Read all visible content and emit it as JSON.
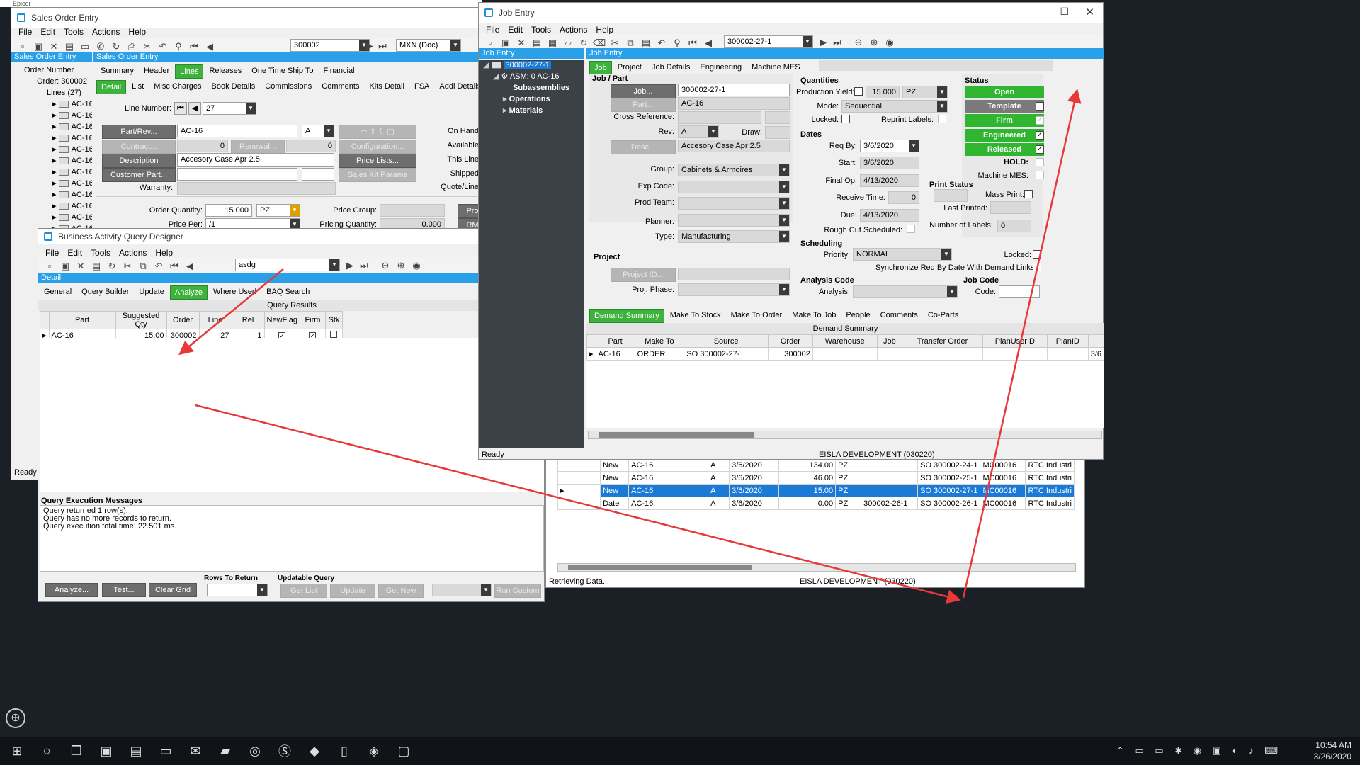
{
  "taskbar_top_title": "Epicor",
  "sales": {
    "title": "Sales Order Entry",
    "menu": [
      "File",
      "Edit",
      "Tools",
      "Actions",
      "Help"
    ],
    "order_number": "300002",
    "currency": "MXN (Doc)",
    "tree_header": "Sales Order Entry",
    "panel_header": "Sales Order Entry",
    "tree": {
      "root": "Order Number",
      "order": "Order: 300002",
      "lines": "Lines (27)",
      "item": "AC-16",
      "count": 18
    },
    "tabs": [
      "Summary",
      "Header",
      "Lines",
      "Releases",
      "One Time Ship To",
      "Financial"
    ],
    "active_tab": "Lines",
    "subtabs": [
      "Detail",
      "List",
      "Misc Charges",
      "Book Details",
      "Commissions",
      "Comments",
      "Kits Detail",
      "FSA",
      "Addl Details"
    ],
    "active_subtab": "Detail",
    "line_number_label": "Line Number:",
    "line_number": "27",
    "part_rev_btn": "Part/Rev...",
    "part": "AC-16",
    "rev": "A",
    "contract_btn": "Contract...",
    "contract_val": "0",
    "renewal_btn": "Renewal...",
    "renewal_val": "0",
    "configuration_btn": "Configuration...",
    "description_btn": "Description",
    "description": "Accesory Case Apr 2.5",
    "price_lists_btn": "Price Lists...",
    "customer_part_btn": "Customer Part...",
    "sales_kit_btn": "Sales Kit Params",
    "warranty_label": "Warranty:",
    "right_labels": [
      "On Hand",
      "Available",
      "This Line",
      "Shipped",
      "Quote/Line"
    ],
    "order_qty_label": "Order Quantity:",
    "order_qty": "15.000",
    "uom": "PZ",
    "price_group_label": "Price Group:",
    "price_per_label": "Price Per:",
    "price_per": "/1",
    "pricing_qty_label": "Pricing Quantity:",
    "pricing_qty": "0.000",
    "pro_btn": "Pro",
    "rm_btn": "RM",
    "status": "Ready"
  },
  "baq": {
    "title": "Business Activity Query Designer",
    "menu": [
      "File",
      "Edit",
      "Tools",
      "Actions",
      "Help"
    ],
    "query_id": "asdg",
    "detail": "Detail",
    "tabs": [
      "General",
      "Query Builder",
      "Update",
      "Analyze",
      "Where Used",
      "BAQ Search"
    ],
    "active_tab": "Analyze",
    "results_title": "Query Results",
    "columns": [
      "Part",
      "Suggested Qty",
      "Order",
      "Line",
      "Rel",
      "NewFlag",
      "Firm",
      "Stk"
    ],
    "row": {
      "part": "AC-16",
      "qty": "15.00",
      "order": "300002",
      "line": "27",
      "rel": "1"
    },
    "messages_title": "Query Execution Messages",
    "messages": [
      "Query returned 1 row(s).",
      "Query has no more records to return.",
      "Query execution total time: 22.501 ms."
    ],
    "btn_analyze": "Analyze...",
    "btn_test": "Test...",
    "btn_clear": "Clear Grid",
    "rows_to_return": "Rows To Return",
    "updatable_query": "Updatable Query",
    "btn_getlist": "Get List",
    "btn_update": "Update",
    "btn_getnew": "Get New",
    "btn_runcustom": "Run Custom",
    "status": "Ready",
    "footer_blur": "EISLA DEVELOPMENT (030220)"
  },
  "job": {
    "title": "Job Entry",
    "menu": [
      "File",
      "Edit",
      "Tools",
      "Actions",
      "Help"
    ],
    "job_number": "300002-27-1",
    "tree_header": "Job Entry",
    "panel_header": "Job Entry",
    "tree": {
      "root": "300002-27-1",
      "asm": "ASM: 0 AC-16",
      "sub": "Subassemblies",
      "ops": "Operations",
      "mats": "Materials"
    },
    "tabs": [
      "Job",
      "Project",
      "Job Details",
      "Engineering",
      "Machine MES"
    ],
    "active_tab": "Job",
    "job_part_header": "Job / Part",
    "job_btn": "Job...",
    "job_val": "300002-27-1",
    "part_btn": "Part...",
    "part_val": "AC-16",
    "crossref_label": "Cross Reference:",
    "rev_label": "Rev:",
    "rev_val": "A",
    "draw_label": "Draw:",
    "desc_btn": "Desc...",
    "desc_val": "Accesory Case Apr 2.5",
    "group_label": "Group:",
    "group_val": "Cabinets & Armoires",
    "expcode_label": "Exp Code:",
    "prodteam_label": "Prod Team:",
    "planner_label": "Planner:",
    "type_label": "Type:",
    "type_val": "Manufacturing",
    "project_header": "Project",
    "projectid_btn": "Project ID...",
    "projphase_label": "Proj. Phase:",
    "quantities_header": "Quantities",
    "prodyield_label": "Production Yield:",
    "prodyield": "15.000",
    "uom": "PZ",
    "mode_label": "Mode:",
    "mode_val": "Sequential",
    "locked_label": "Locked:",
    "reprint_label": "Reprint Labels:",
    "dates_header": "Dates",
    "reqby_label": "Req By:",
    "reqby": "3/6/2020",
    "start_label": "Start:",
    "start": "3/6/2020",
    "finalop_label": "Final Op:",
    "finalop": "4/13/2020",
    "receive_label": "Receive Time:",
    "receive": "0",
    "due_label": "Due:",
    "due": "4/13/2020",
    "rough_label": "Rough Cut Scheduled:",
    "status_header": "Status",
    "status_btns": [
      {
        "label": "Open",
        "color": "#2fb52f"
      },
      {
        "label": "Template",
        "color": "#7a7a7a"
      },
      {
        "label": "Firm",
        "color": "#2fb52f"
      },
      {
        "label": "Engineered",
        "color": "#2fb52f"
      },
      {
        "label": "Released",
        "color": "#2fb52f"
      }
    ],
    "hold_label": "HOLD:",
    "machine_mes_label": "Machine MES:",
    "print_status_header": "Print Status",
    "mass_print_label": "Mass Print:",
    "last_printed_label": "Last Printed:",
    "num_labels_label": "Number of Labels:",
    "num_labels": "0",
    "scheduling_header": "Scheduling",
    "priority_label": "Priority:",
    "priority": "NORMAL",
    "sched_locked_label": "Locked:",
    "sync_label": "Synchronize Req By Date With Demand Links:",
    "analysis_header": "Analysis Code",
    "analysis_label": "Analysis:",
    "jobcode_header": "Job Code",
    "code_label": "Code:",
    "demand_tabs": [
      "Demand Summary",
      "Make To Stock",
      "Make To Order",
      "Make To Job",
      "People",
      "Comments",
      "Co-Parts"
    ],
    "demand_title": "Demand Summary",
    "demand_cols": [
      "Part",
      "Make To",
      "Source",
      "Order",
      "Warehouse",
      "Job",
      "Transfer Order",
      "PlanUserID",
      "PlanID"
    ],
    "demand_row": {
      "part": "AC-16",
      "make_to": "ORDER",
      "source": "SO 300002-27-",
      "order": "300002",
      "extra": "3/6"
    },
    "status": "Ready",
    "footer": "EISLA DEVELOPMENT (030220)"
  },
  "bg": {
    "rows": [
      {
        "type": "New",
        "part": "AC-16",
        "rev": "A",
        "date": "3/6/2020",
        "qty": "134.00",
        "uom": "PZ",
        "job": "",
        "so": "SO 300002-24-1",
        "mc": "MC00016",
        "co": "RTC Industri"
      },
      {
        "type": "New",
        "part": "AC-16",
        "rev": "A",
        "date": "3/6/2020",
        "qty": "46.00",
        "uom": "PZ",
        "job": "",
        "so": "SO 300002-25-1",
        "mc": "MC00016",
        "co": "RTC Industri"
      },
      {
        "type": "New",
        "part": "AC-16",
        "rev": "A",
        "date": "3/6/2020",
        "qty": "15.00",
        "uom": "PZ",
        "job": "",
        "so": "SO 300002-27-1",
        "mc": "MC00016",
        "co": "RTC Industri"
      },
      {
        "type": "Date",
        "part": "AC-16",
        "rev": "A",
        "date": "3/6/2020",
        "qty": "0.00",
        "uom": "PZ",
        "job": "300002-26-1",
        "so": "SO 300002-26-1",
        "mc": "MC00016",
        "co": "RTC Industri"
      }
    ],
    "status": "Retrieving Data...",
    "footer": "EISLA DEVELOPMENT (030220)"
  },
  "taskbar": {
    "time": "10:54 AM",
    "date": "3/26/2020"
  },
  "colors": {
    "accent": "#29a0e8",
    "green": "#3db33d",
    "arrow": "#e8383a",
    "selected": "#1a7ad6"
  }
}
